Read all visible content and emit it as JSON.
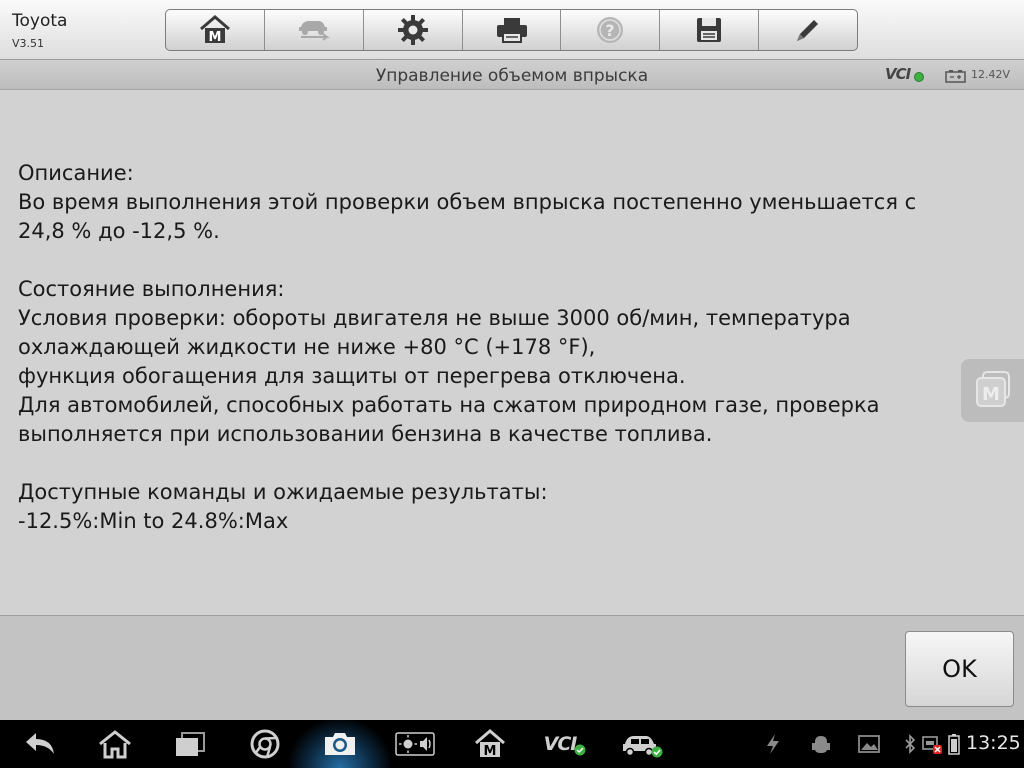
{
  "app": {
    "name": "Toyota",
    "version": "V3.51"
  },
  "toolbar": {
    "buttons": [
      {
        "name": "home-icon",
        "label": "Home"
      },
      {
        "name": "vehicle-swap-icon",
        "label": "Vehicle swap"
      },
      {
        "name": "settings-gear-icon",
        "label": "Settings"
      },
      {
        "name": "printer-icon",
        "label": "Print"
      },
      {
        "name": "help-icon",
        "label": "Help"
      },
      {
        "name": "save-floppy-icon",
        "label": "Save"
      },
      {
        "name": "edit-pencil-icon",
        "label": "Edit"
      }
    ]
  },
  "header": {
    "title": "Управление объемом впрыска",
    "vci_label": "VCI",
    "vci_status": "connected",
    "battery_voltage": "12.42V"
  },
  "content": {
    "lines": [
      "Описание:",
      "Во время выполнения этой проверки объем впрыска постепенно уменьшается с",
      "24,8 % до -12,5 %.",
      "",
      "Состояние выполнения:",
      "Условия проверки: обороты двигателя не выше 3000 об/мин, температура",
      "охлаждающей жидкости не ниже +80 °C (+178 °F),",
      "функция обогащения для защиты от перегрева отключена.",
      "Для автомобилей, способных работать на сжатом природном газе, проверка",
      "выполняется при использовании бензина в качестве топлива.",
      "",
      "Доступные команды и ожидаемые результаты:",
      "-12.5%:Min to 24.8%:Max"
    ]
  },
  "actions": {
    "ok_label": "OK"
  },
  "system_bar": {
    "vci_label": "VCI",
    "clock": "13:25"
  },
  "colors": {
    "background": "#d2d2d2",
    "navbar": "#000000",
    "status_ok": "#3cb043",
    "accent_glow": "#2878b4"
  }
}
